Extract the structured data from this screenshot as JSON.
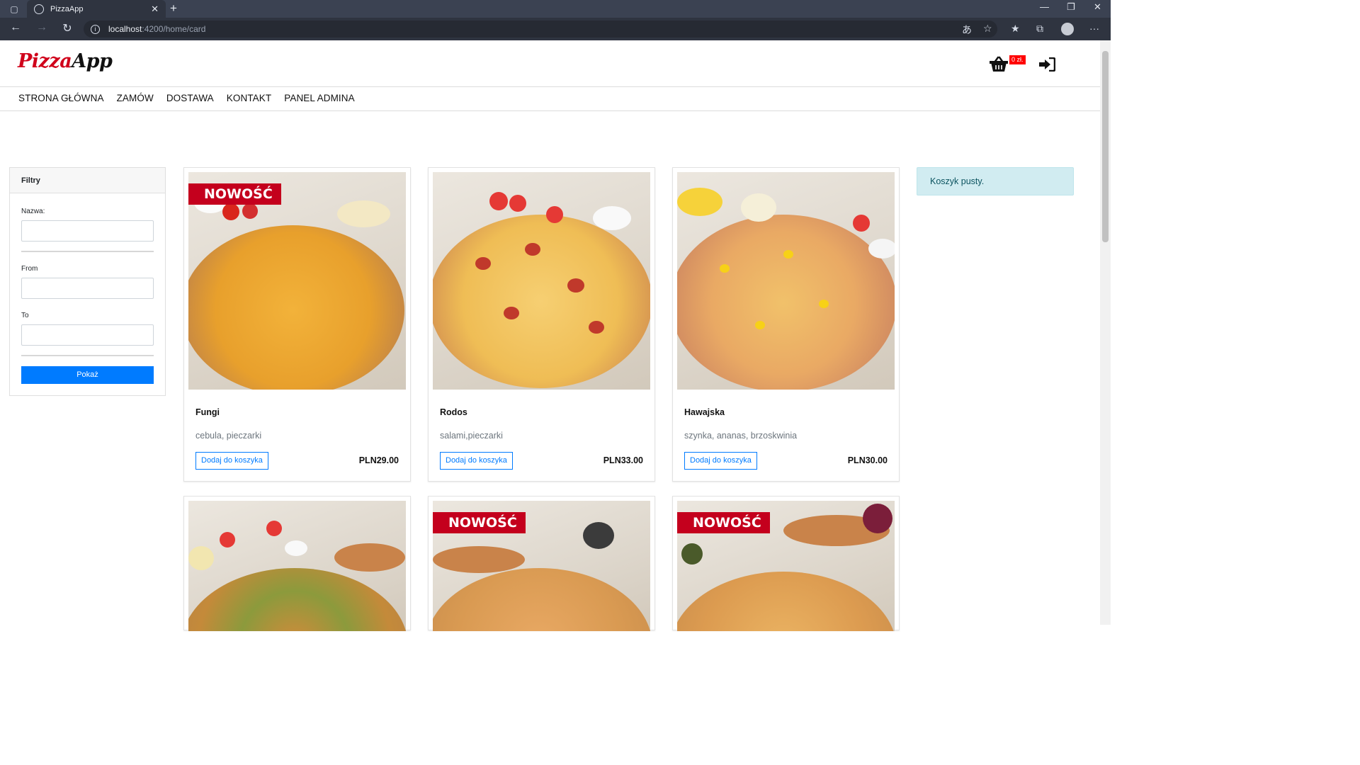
{
  "browser": {
    "tab_title": "PizzaApp",
    "url_host": "localhost",
    "url_path": ":4200/home/card"
  },
  "header": {
    "logo_part1": "Pizza",
    "logo_part2": "App",
    "cart_badge": "0 zł.",
    "icons": [
      "basket-icon",
      "sign-in-icon"
    ]
  },
  "nav": {
    "items": [
      "STRONA GŁÓWNA",
      "ZAMÓW",
      "DOSTAWA",
      "KONTAKT",
      "PANEL ADMINA"
    ]
  },
  "filters": {
    "title": "Filtry",
    "name_label": "Nazwa:",
    "from_label": "From",
    "to_label": "To",
    "submit_label": "Pokaż"
  },
  "cart": {
    "empty_message": "Koszyk pusty."
  },
  "products": [
    {
      "name": "Fungi",
      "description": "cebula, pieczarki",
      "price": "PLN29.00",
      "button": "Dodaj do koszyka",
      "badge": "NOWOŚĆ"
    },
    {
      "name": "Rodos",
      "description": "salami,pieczarki",
      "price": "PLN33.00",
      "button": "Dodaj do koszyka",
      "badge": ""
    },
    {
      "name": "Hawajska",
      "description": "szynka, ananas, brzoskwinia",
      "price": "PLN30.00",
      "button": "Dodaj do koszyka",
      "badge": ""
    },
    {
      "badge": ""
    },
    {
      "badge": "NOWOŚĆ"
    },
    {
      "badge": "NOWOŚĆ"
    }
  ],
  "colors": {
    "accent": "#007bff",
    "brand_red": "#d0021b",
    "badge_red": "#c4001d",
    "alert_bg": "#d1ecf1"
  }
}
